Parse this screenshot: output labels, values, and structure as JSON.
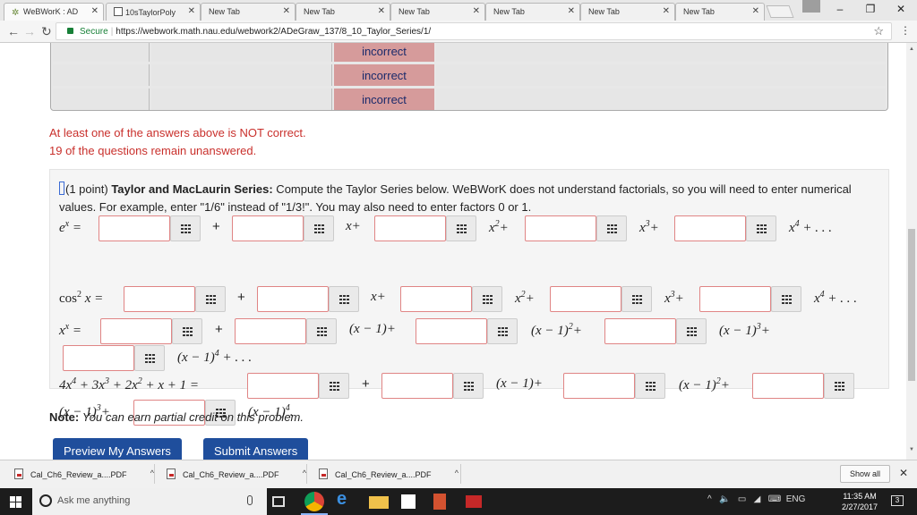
{
  "browser": {
    "tabs": [
      {
        "label": "WeBWorK : AD"
      },
      {
        "label": "10sTaylorPoly"
      },
      {
        "label": "New Tab"
      },
      {
        "label": "New Tab"
      },
      {
        "label": "New Tab"
      },
      {
        "label": "New Tab"
      },
      {
        "label": "New Tab"
      },
      {
        "label": "New Tab"
      }
    ],
    "secure_label": "Secure",
    "url": "https://webwork.math.nau.edu/webwork2/ADeGraw_137/8_10_Taylor_Series/1/"
  },
  "results": {
    "rows": [
      {
        "status": "incorrect"
      },
      {
        "status": "incorrect"
      },
      {
        "status": "incorrect"
      }
    ]
  },
  "messages": {
    "not_correct": "At least one of the answers above is NOT correct.",
    "unanswered": "19 of the questions remain unanswered."
  },
  "problem": {
    "points": "(1 point) ",
    "title": "Taylor and MacLaurin Series:",
    "instructions": " Compute the Taylor Series below. WeBWorK does not understand factorials, so you will need to enter numerical values. For example, enter \"1/6\" instead of \"1/3!\". You may also need to enter factors 0 or 1."
  },
  "math": {
    "ex_lhs": "e",
    "ex_lhs_sup": "x",
    "eq": "=",
    "plus": "+",
    "x_plus": "x+",
    "x2": "x",
    "x3": "x",
    "x4": "x",
    "sup2": "2",
    "sup3": "3",
    "sup4": "4",
    "tail_plus": "+",
    "dots": ". . .",
    "cos_lhs": "cos",
    "cos_x": "x",
    "xx_lhs": "x",
    "xx_sup": "x",
    "xm1_plus": "(x − 1)+",
    "xm1": "(x − 1)",
    "poly_lhs": "4x",
    "poly_mid1": " + 3x",
    "poly_mid2": " + 2x",
    "poly_tail": " + x + 1 =",
    "period": "."
  },
  "note": {
    "label": "Note:",
    "text": "You can earn partial credit on this problem."
  },
  "buttons": {
    "preview": "Preview My Answers",
    "submit": "Submit Answers"
  },
  "downloads": {
    "items": [
      {
        "label": "Cal_Ch6_Review_a....PDF"
      },
      {
        "label": "Cal_Ch6_Review_a....PDF"
      },
      {
        "label": "Cal_Ch6_Review_a....PDF"
      }
    ],
    "show_all": "Show all"
  },
  "taskbar": {
    "search_placeholder": "Ask me anything",
    "lang": "ENG",
    "time": "11:35 AM",
    "date": "2/27/2017",
    "notif_count": "3"
  },
  "colors": {
    "incorrect_bg": "#d69b9b",
    "error_text": "#c9302c",
    "button_blue": "#1f4e9c",
    "answer_border": "#e08585"
  }
}
